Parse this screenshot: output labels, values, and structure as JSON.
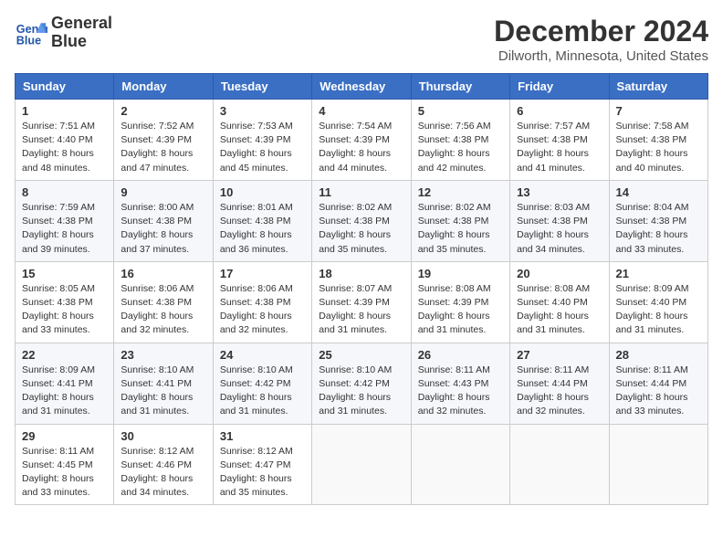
{
  "header": {
    "logo_line1": "General",
    "logo_line2": "Blue",
    "month": "December 2024",
    "location": "Dilworth, Minnesota, United States"
  },
  "weekdays": [
    "Sunday",
    "Monday",
    "Tuesday",
    "Wednesday",
    "Thursday",
    "Friday",
    "Saturday"
  ],
  "weeks": [
    [
      {
        "day": "1",
        "sunrise": "7:51 AM",
        "sunset": "4:40 PM",
        "daylight": "8 hours and 48 minutes."
      },
      {
        "day": "2",
        "sunrise": "7:52 AM",
        "sunset": "4:39 PM",
        "daylight": "8 hours and 47 minutes."
      },
      {
        "day": "3",
        "sunrise": "7:53 AM",
        "sunset": "4:39 PM",
        "daylight": "8 hours and 45 minutes."
      },
      {
        "day": "4",
        "sunrise": "7:54 AM",
        "sunset": "4:39 PM",
        "daylight": "8 hours and 44 minutes."
      },
      {
        "day": "5",
        "sunrise": "7:56 AM",
        "sunset": "4:38 PM",
        "daylight": "8 hours and 42 minutes."
      },
      {
        "day": "6",
        "sunrise": "7:57 AM",
        "sunset": "4:38 PM",
        "daylight": "8 hours and 41 minutes."
      },
      {
        "day": "7",
        "sunrise": "7:58 AM",
        "sunset": "4:38 PM",
        "daylight": "8 hours and 40 minutes."
      }
    ],
    [
      {
        "day": "8",
        "sunrise": "7:59 AM",
        "sunset": "4:38 PM",
        "daylight": "8 hours and 39 minutes."
      },
      {
        "day": "9",
        "sunrise": "8:00 AM",
        "sunset": "4:38 PM",
        "daylight": "8 hours and 37 minutes."
      },
      {
        "day": "10",
        "sunrise": "8:01 AM",
        "sunset": "4:38 PM",
        "daylight": "8 hours and 36 minutes."
      },
      {
        "day": "11",
        "sunrise": "8:02 AM",
        "sunset": "4:38 PM",
        "daylight": "8 hours and 35 minutes."
      },
      {
        "day": "12",
        "sunrise": "8:02 AM",
        "sunset": "4:38 PM",
        "daylight": "8 hours and 35 minutes."
      },
      {
        "day": "13",
        "sunrise": "8:03 AM",
        "sunset": "4:38 PM",
        "daylight": "8 hours and 34 minutes."
      },
      {
        "day": "14",
        "sunrise": "8:04 AM",
        "sunset": "4:38 PM",
        "daylight": "8 hours and 33 minutes."
      }
    ],
    [
      {
        "day": "15",
        "sunrise": "8:05 AM",
        "sunset": "4:38 PM",
        "daylight": "8 hours and 33 minutes."
      },
      {
        "day": "16",
        "sunrise": "8:06 AM",
        "sunset": "4:38 PM",
        "daylight": "8 hours and 32 minutes."
      },
      {
        "day": "17",
        "sunrise": "8:06 AM",
        "sunset": "4:38 PM",
        "daylight": "8 hours and 32 minutes."
      },
      {
        "day": "18",
        "sunrise": "8:07 AM",
        "sunset": "4:39 PM",
        "daylight": "8 hours and 31 minutes."
      },
      {
        "day": "19",
        "sunrise": "8:08 AM",
        "sunset": "4:39 PM",
        "daylight": "8 hours and 31 minutes."
      },
      {
        "day": "20",
        "sunrise": "8:08 AM",
        "sunset": "4:40 PM",
        "daylight": "8 hours and 31 minutes."
      },
      {
        "day": "21",
        "sunrise": "8:09 AM",
        "sunset": "4:40 PM",
        "daylight": "8 hours and 31 minutes."
      }
    ],
    [
      {
        "day": "22",
        "sunrise": "8:09 AM",
        "sunset": "4:41 PM",
        "daylight": "8 hours and 31 minutes."
      },
      {
        "day": "23",
        "sunrise": "8:10 AM",
        "sunset": "4:41 PM",
        "daylight": "8 hours and 31 minutes."
      },
      {
        "day": "24",
        "sunrise": "8:10 AM",
        "sunset": "4:42 PM",
        "daylight": "8 hours and 31 minutes."
      },
      {
        "day": "25",
        "sunrise": "8:10 AM",
        "sunset": "4:42 PM",
        "daylight": "8 hours and 31 minutes."
      },
      {
        "day": "26",
        "sunrise": "8:11 AM",
        "sunset": "4:43 PM",
        "daylight": "8 hours and 32 minutes."
      },
      {
        "day": "27",
        "sunrise": "8:11 AM",
        "sunset": "4:44 PM",
        "daylight": "8 hours and 32 minutes."
      },
      {
        "day": "28",
        "sunrise": "8:11 AM",
        "sunset": "4:44 PM",
        "daylight": "8 hours and 33 minutes."
      }
    ],
    [
      {
        "day": "29",
        "sunrise": "8:11 AM",
        "sunset": "4:45 PM",
        "daylight": "8 hours and 33 minutes."
      },
      {
        "day": "30",
        "sunrise": "8:12 AM",
        "sunset": "4:46 PM",
        "daylight": "8 hours and 34 minutes."
      },
      {
        "day": "31",
        "sunrise": "8:12 AM",
        "sunset": "4:47 PM",
        "daylight": "8 hours and 35 minutes."
      },
      null,
      null,
      null,
      null
    ]
  ]
}
